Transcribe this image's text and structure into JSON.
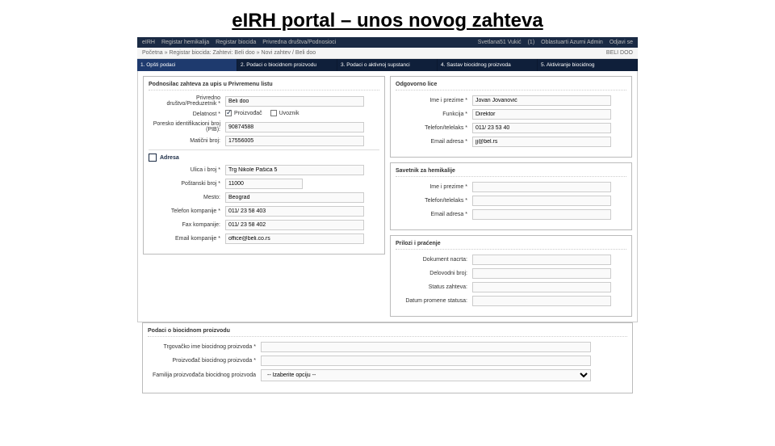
{
  "slide_title": "eIRH portal – unos novog zahteva",
  "topbar": {
    "items": [
      "eIRH",
      "Registar hemikalija",
      "Registar biocida",
      "Privredna društva/Podnosioci",
      "Svetlana51 Vukić",
      "(1)",
      "Oblastuarti Azurni Admin",
      "Odjavi se"
    ]
  },
  "breadcrumb": {
    "path": "Početna » Registar biocida: Zahtevi: Beli doo » Novi zahtev / Beli doo",
    "right": "BELI DOO"
  },
  "steps": [
    "1. Opšti podaci",
    "2. Podaci o biocidnom proizvodu",
    "3. Podaci o aktivnoj supstanci",
    "4. Sastav biocidnog proizvoda",
    "5. Aktiviranje biocidnog"
  ],
  "left": {
    "panel1_title": "Podnosilac zahteva za upis u Privremenu listu",
    "fields": {
      "pd_label": "Privredno društvo/Preduzetnik *",
      "pd_val": "Beli doo",
      "del_label": "Delatnost *",
      "del_opt1": "Proizvođač",
      "del_opt2": "Uvoznik",
      "pib_label": "Poresko identifikacioni broj (PIB):",
      "pib_val": "90874588",
      "mb_label": "Matični broj:",
      "mb_val": "17556005",
      "adresa_hdr": "Adresa",
      "ul_label": "Ulica i broj *",
      "ul_val": "Trg Nikole Pašića 5",
      "pb_label": "Poštanski broj *",
      "pb_val": "11000",
      "mesto_label": "Mesto:",
      "mesto_val": "Beograd",
      "tel_label": "Telefon kompanije *",
      "tel_val": "011/ 23 58 403",
      "fax_label": "Fax kompanije:",
      "fax_val": "011/ 23 58 402",
      "email_label": "Email kompanije *",
      "email_val": "office@beli.co.rs"
    }
  },
  "right": {
    "p1_title": "Odgovorno lice",
    "p1": {
      "ime_label": "Ime i prezime *",
      "ime_val": "Jovan Jovanović",
      "fun_label": "Funkcija *",
      "fun_val": "Direktor",
      "tel_label": "Telefon/telelaks *",
      "tel_val": "011/ 23 53 40",
      "em_label": "Email adresa *",
      "em_val": "jj@bel.rs"
    },
    "p2_title": "Savetnik za hemikalije",
    "p2": {
      "ime_label": "Ime i prezime *",
      "tel_label": "Telefon/telelaks *",
      "em_label": "Email adresa *"
    },
    "p3_title": "Prilozi i praćenje",
    "p3": {
      "d1": "Dokument nacrta:",
      "d2": "Delovodni broj:",
      "d3": "Status zahteva:",
      "d4": "Datum promene statusa:"
    }
  },
  "bottom": {
    "title": "Podaci o biocidnom proizvodu",
    "f1": "Trgovačko ime biocidnog proizvoda *",
    "f2": "Proizvođač biocidnog proizvoda *",
    "f3": "Familija proizvođača biocidnog proizvoda",
    "f3_val": "-- Izaberite opciju --"
  }
}
